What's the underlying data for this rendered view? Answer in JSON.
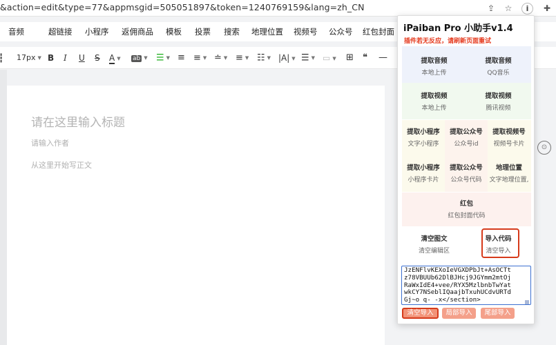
{
  "browser": {
    "url": "&action=edit&type=77&appmsgid=505051897&token=1240769159&lang=zh_CN",
    "icons": [
      "share-icon",
      "star-icon",
      "info-icon",
      "puzzle-icon"
    ],
    "info_label": "i"
  },
  "menubar": {
    "items": [
      "音频",
      "超链接",
      "小程序",
      "返佣商品",
      "模板",
      "投票",
      "搜索",
      "地理位置",
      "视频号",
      "公众号",
      "红包封面"
    ]
  },
  "toolbar": {
    "font_size": "17px",
    "bold": "B",
    "italic": "I",
    "underline": "U",
    "strike": "S",
    "color": "A",
    "bg_color": "ab",
    "table": "⊞",
    "quote": "❝",
    "hr": "—"
  },
  "editor": {
    "title_placeholder": "请在这里输入标题",
    "author_placeholder": "请输入作者",
    "body_placeholder": "从这里开始写正文"
  },
  "popup": {
    "title": "iPaiban Pro 小助手v1.4",
    "subtitle": "插件若无反应，请刷新页面重试",
    "tiles": [
      {
        "label": "提取音频",
        "sub": "本地上传"
      },
      {
        "label": "提取音频",
        "sub": "QQ音乐"
      },
      {
        "label": "提取视频",
        "sub": "本地上传"
      },
      {
        "label": "提取视频",
        "sub": "腾讯视频"
      },
      {
        "label": "提取小程序",
        "sub": "文字小程序"
      },
      {
        "label": "提取公众号",
        "sub": "公众号id"
      },
      {
        "label": "提取视频号",
        "sub": "视频号卡片"
      },
      {
        "label": "提取小程序",
        "sub": "小程序卡片"
      },
      {
        "label": "提取公众号",
        "sub": "公众号代码"
      },
      {
        "label": "地理位置",
        "sub": "文字地理位置,"
      },
      {
        "label": "红包",
        "sub": "红包封面代码"
      },
      {
        "label": "清空图文",
        "sub": "清空编辑区"
      },
      {
        "label": "导入代码",
        "sub": "清空导入"
      }
    ],
    "code_text": "JzENFlvKEXoIeVGXDPbJt+AsOCTt\nz78VBUUb62DlBJHcj9JGYmm2mtOj\nRaWxIdE4+vee/RYX5MzlbnbTwYat\nwkCY7NSeblIQaajbTxuhUCdvURTd\nGj~o q- -x</section>",
    "buttons": [
      "清空导入",
      "局部导入",
      "尾部导入"
    ]
  }
}
